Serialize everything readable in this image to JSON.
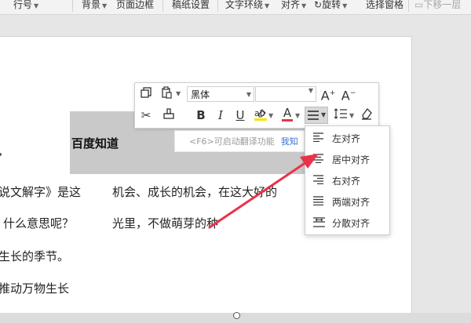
{
  "ribbon": {
    "items": [
      "行号",
      "背景",
      "页面边框",
      "稿纸设置",
      "文字环绕",
      "对齐",
      "旋转",
      "选择窗格",
      "下移一层"
    ]
  },
  "document": {
    "title": "百度知道",
    "translate_hint": "<F6>可启动翻译功能",
    "translate_link": "我知",
    "lines_left": [
      "说文解字》是这",
      "什么意思呢？",
      "生长的季节。",
      "推动万物生长"
    ],
    "lines_right": [
      "机会、成长的机会，在这大好的",
      "光里，不做萌芽的种"
    ]
  },
  "mini_toolbar": {
    "font_name": "黑体",
    "font_size": "",
    "bold": "B",
    "italic": "I",
    "underline": "U",
    "font_color": "A",
    "grow_font": "A",
    "shrink_font": "A"
  },
  "align_menu": {
    "items": [
      "左对齐",
      "居中对齐",
      "右对齐",
      "两端对齐",
      "分散对齐"
    ]
  },
  "colors": {
    "highlight": "#f5e300",
    "font_color_bar": "#e03b3b",
    "arrow": "#e8334a",
    "link": "#3b6fd1"
  }
}
